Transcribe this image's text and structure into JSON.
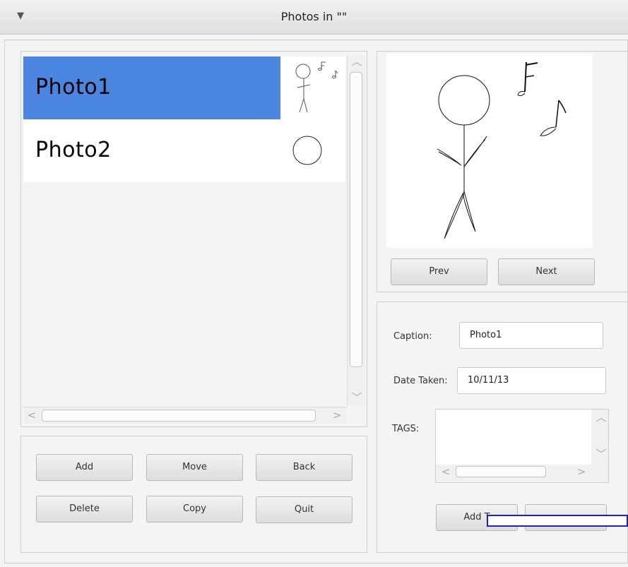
{
  "window": {
    "title": "Photos in \"\""
  },
  "photo_list": {
    "items": [
      {
        "label": "Photo1",
        "selected": true,
        "thumbnail": "stick-figure-with-notes"
      },
      {
        "label": "Photo2",
        "selected": false,
        "thumbnail": "circle"
      }
    ]
  },
  "list_buttons": {
    "add": "Add",
    "move": "Move",
    "back": "Back",
    "delete": "Delete",
    "copy": "Copy",
    "quit": "Quit"
  },
  "preview": {
    "image": "stick-figure-with-notes",
    "prev": "Prev",
    "next": "Next"
  },
  "details": {
    "caption_label": "Caption:",
    "caption_value": "Photo1",
    "date_label": "Date Taken:",
    "date_value": "10/11/13",
    "tags_label": "TAGS:",
    "add_tag_button": "Add T"
  },
  "colors": {
    "selection": "#4a86e0",
    "overlay_border": "#1e1ecc"
  }
}
